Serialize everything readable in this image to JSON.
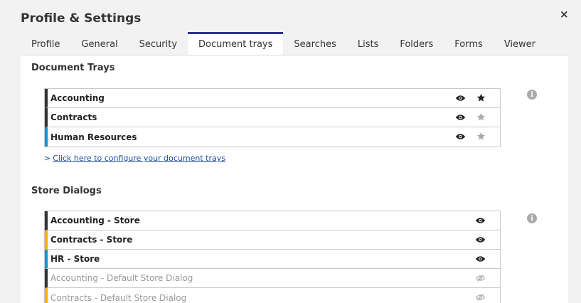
{
  "dialog": {
    "title": "Profile & Settings",
    "close_label": "×"
  },
  "tabs": [
    {
      "label": "Profile"
    },
    {
      "label": "General"
    },
    {
      "label": "Security"
    },
    {
      "label": "Document trays",
      "active": true
    },
    {
      "label": "Searches"
    },
    {
      "label": "Lists"
    },
    {
      "label": "Folders"
    },
    {
      "label": "Forms"
    },
    {
      "label": "Viewer"
    }
  ],
  "document_trays": {
    "title": "Document Trays",
    "items": [
      {
        "label": "Accounting",
        "color": "#333333",
        "visible": true,
        "favorite": true
      },
      {
        "label": "Contracts",
        "color": "#333333",
        "visible": true,
        "favorite": false
      },
      {
        "label": "Human Resources",
        "color": "#1e90c8",
        "visible": true,
        "favorite": false
      }
    ],
    "config_link": {
      "chevron": ">",
      "label": "Click here to configure your document trays"
    }
  },
  "store_dialogs": {
    "title": "Store Dialogs",
    "items": [
      {
        "label": "Accounting - Store",
        "color": "#333333",
        "visible": true
      },
      {
        "label": "Contracts - Store",
        "color": "#f0b400",
        "visible": true
      },
      {
        "label": "HR - Store",
        "color": "#1e90c8",
        "visible": true
      },
      {
        "label": "Accounting - Default Store Dialog",
        "color": "#333333",
        "visible": false
      },
      {
        "label": "Contracts - Default Store Dialog",
        "color": "#f0b400",
        "visible": false
      }
    ]
  },
  "icons": {
    "eye": "eye-icon",
    "eye_off": "eye-slash-icon",
    "star": "star-icon",
    "info": "info-icon",
    "close": "close-icon",
    "info_glyph": "i"
  },
  "colors": {
    "active_tab_border": "#2e3192",
    "link": "#1a4d9e",
    "star_on": "#222222",
    "star_off": "#aaaaaa"
  }
}
